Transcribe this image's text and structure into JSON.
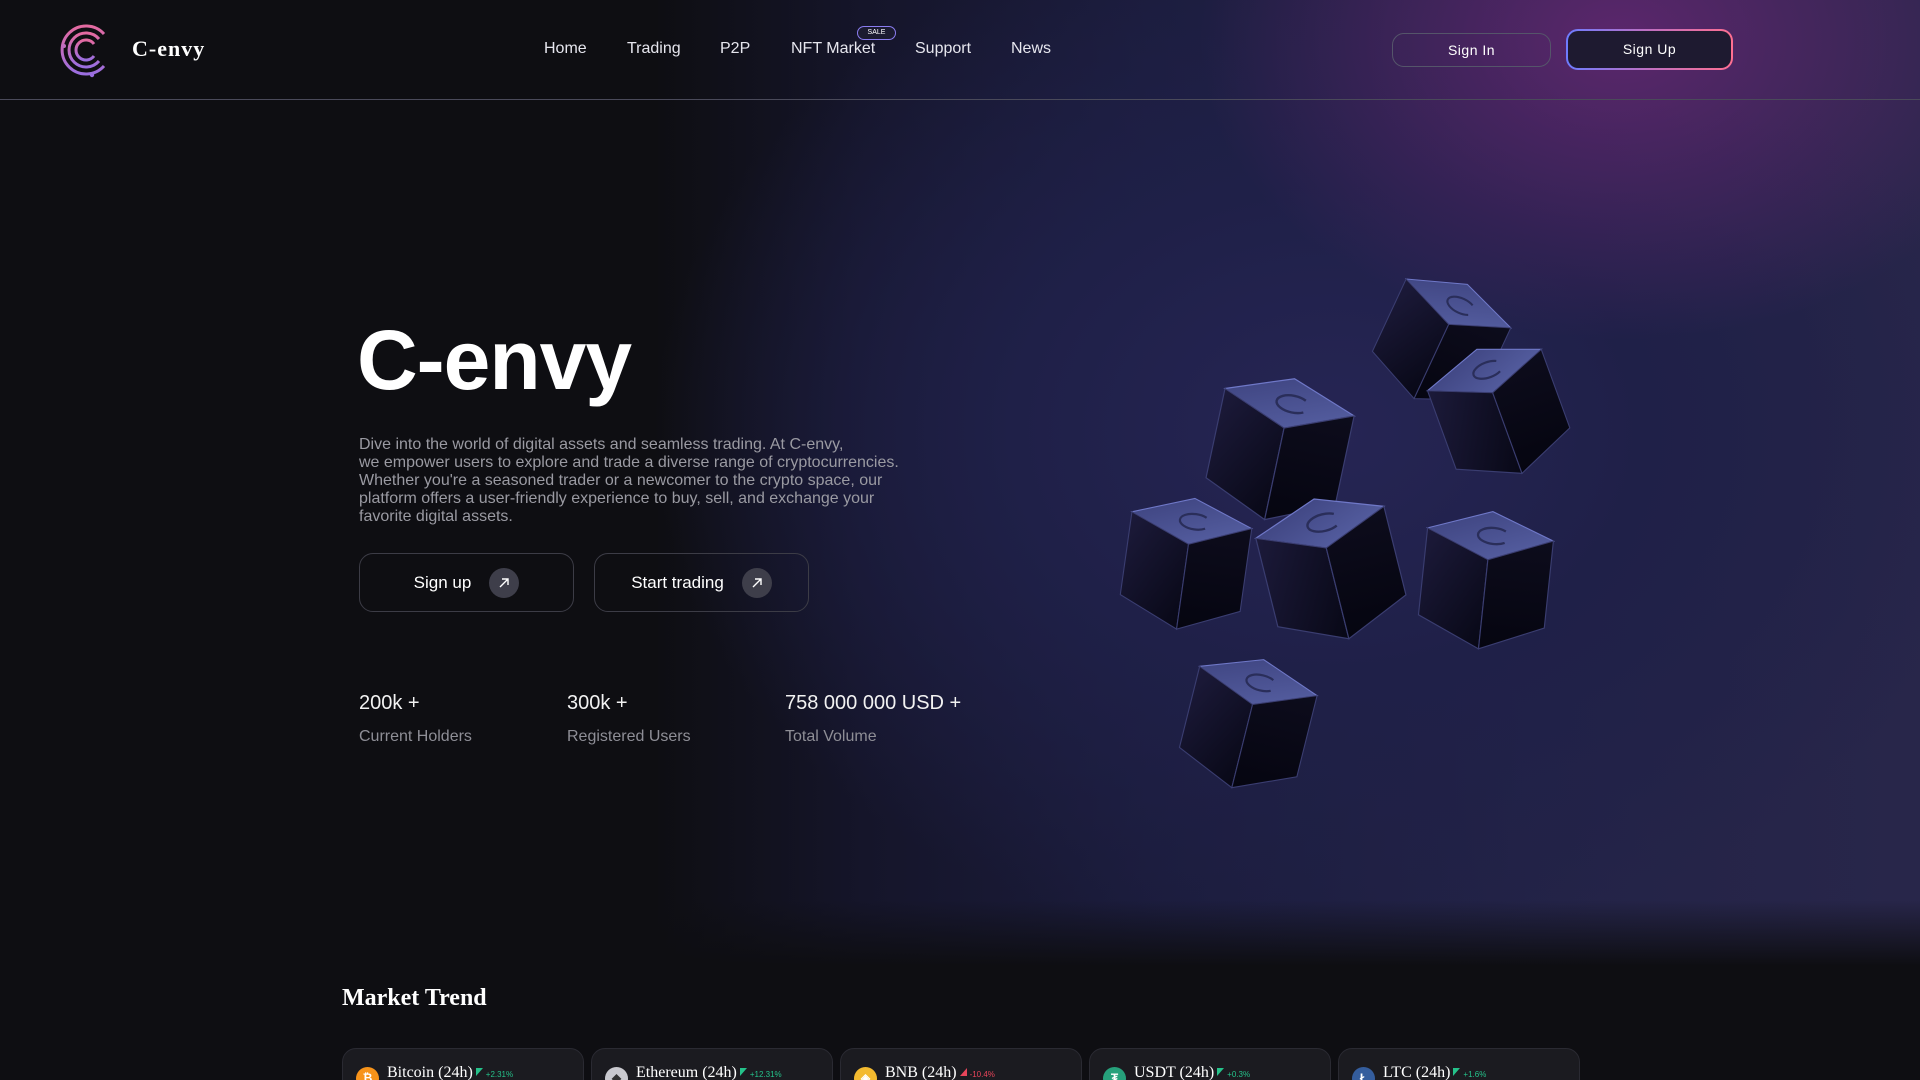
{
  "brand": "C-envy",
  "nav": {
    "links": [
      "Home",
      "Trading",
      "P2P",
      "NFT Market",
      "Support",
      "News"
    ],
    "sale_badge": "SALE",
    "sign_in": "Sign In",
    "sign_up": "Sign Up"
  },
  "hero": {
    "title": "C-envy",
    "description": "Dive into the world of digital assets and seamless trading. At C-envy,\nwe empower users to explore and trade a diverse range of cryptocurrencies.\nWhether you're a seasoned trader or a newcomer to the crypto space, our\nplatform offers a user-friendly experience to buy, sell, and exchange your\nfavorite digital assets.",
    "signup_btn": "Sign up",
    "trade_btn": "Start trading",
    "stats": [
      {
        "value": "200k +",
        "label": "Current Holders"
      },
      {
        "value": "300k +",
        "label": "Registered Users"
      },
      {
        "value": "758 000 000 USD +",
        "label": "Total Volume"
      }
    ]
  },
  "market": {
    "title": "Market Trend",
    "cards": [
      {
        "name": "Bitcoin (24h)",
        "change": "+2.31%",
        "direction": "up",
        "icon": "bitcoin-icon",
        "symbol": "₿",
        "color": "#f7931a"
      },
      {
        "name": "Ethereum (24h)",
        "change": "+12.31%",
        "direction": "up",
        "icon": "ethereum-icon",
        "symbol": "◆",
        "color": "#c9c9cf"
      },
      {
        "name": "BNB (24h)",
        "change": "-10.4%",
        "direction": "down",
        "icon": "bnb-icon",
        "symbol": "◈",
        "color": "#f3ba2f"
      },
      {
        "name": "USDT (24h)",
        "change": "+0.3%",
        "direction": "up",
        "icon": "usdt-icon",
        "symbol": "₮",
        "color": "#26a17b"
      },
      {
        "name": "LTC (24h)",
        "change": "+1.6%",
        "direction": "up",
        "icon": "ltc-icon",
        "symbol": "Ł",
        "color": "#345d9d"
      }
    ],
    "up_color": "#25c28a",
    "down_color": "#e8455a"
  }
}
